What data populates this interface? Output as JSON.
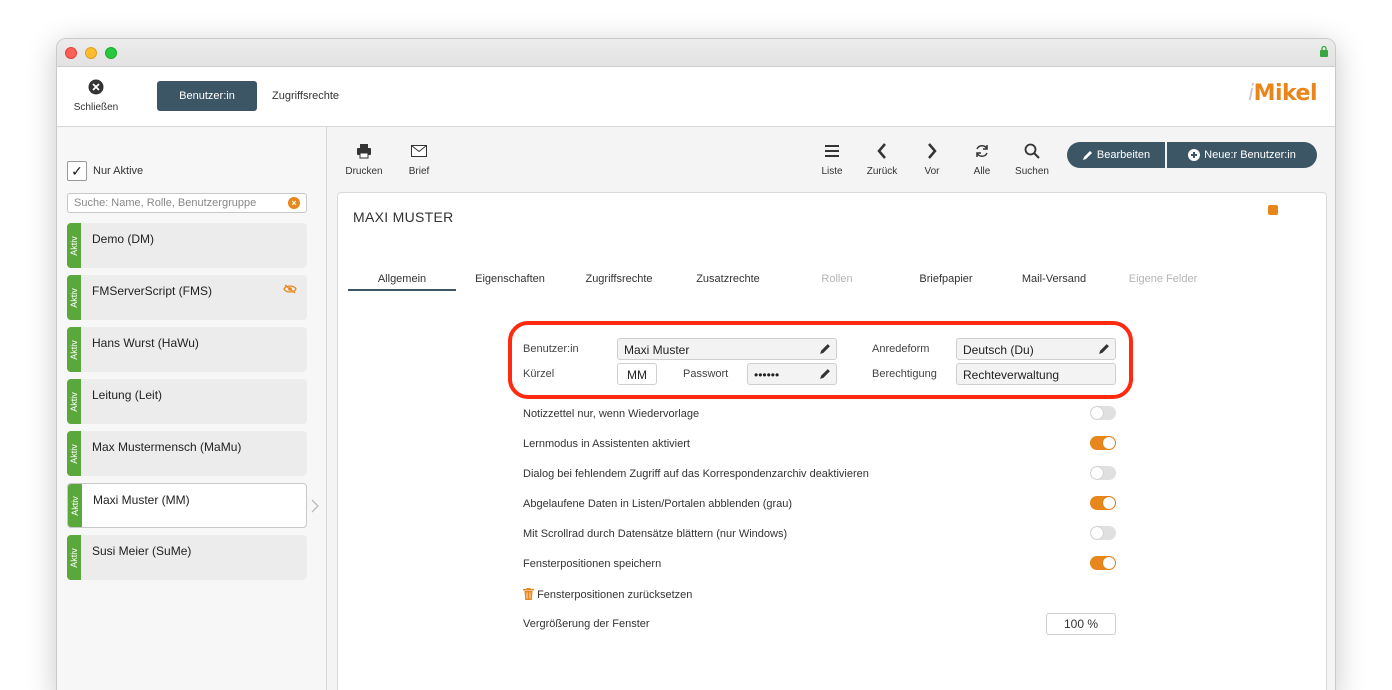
{
  "window": {
    "colors": {
      "accent": "#3d5666",
      "brand": "#e8861b",
      "active_green": "#5aa83c",
      "highlight": "#ff2a10"
    }
  },
  "topbar": {
    "close_label": "Schließen",
    "tab_users": "Benutzer:in",
    "tab_access": "Zugriffsrechte",
    "logo_i": "i",
    "logo_text": "Mikel"
  },
  "sidebar": {
    "filter_label": "Nur Aktive",
    "filter_checked": true,
    "search_placeholder": "Suche: Name, Rolle, Benutzergruppe",
    "status_label": "Aktiv",
    "items": [
      {
        "label": "Demo (DM)"
      },
      {
        "label": "FMServerScript (FMS)"
      },
      {
        "label": "Hans Wurst (HaWu)"
      },
      {
        "label": "Leitung (Leit)"
      },
      {
        "label": "Max Mustermensch (MaMu)"
      },
      {
        "label": "Maxi Muster (MM)"
      },
      {
        "label": "Susi Meier (SuMe)"
      }
    ]
  },
  "toolbar": {
    "print": "Drucken",
    "letter": "Brief",
    "list": "Liste",
    "back": "Zurück",
    "forward": "Vor",
    "all": "Alle",
    "search": "Suchen",
    "edit": "Bearbeiten",
    "new_user": "Neue:r Benutzer:in"
  },
  "record": {
    "title": "MAXI MUSTER",
    "tabs": [
      {
        "label": "Allgemein"
      },
      {
        "label": "Eigenschaften"
      },
      {
        "label": "Zugriffsrechte"
      },
      {
        "label": "Zusatzrechte"
      },
      {
        "label": "Rollen"
      },
      {
        "label": "Briefpapier"
      },
      {
        "label": "Mail-Versand"
      },
      {
        "label": "Eigene Felder"
      }
    ],
    "form": {
      "user_label": "Benutzer:in",
      "user_value": "Maxi Muster",
      "salutation_label": "Anredeform",
      "salutation_value": "Deutsch (Du)",
      "short_label": "Kürzel",
      "short_value": "MM",
      "password_label": "Passwort",
      "password_value": "••••••",
      "permission_label": "Berechtigung",
      "permission_value": "Rechteverwaltung"
    },
    "settings": [
      {
        "label": "Notizzettel nur, wenn Wiedervorlage",
        "on": false
      },
      {
        "label": "Lernmodus in Assistenten aktiviert",
        "on": true
      },
      {
        "label": "Dialog bei fehlendem Zugriff auf das Korrespondenzarchiv deaktivieren",
        "on": false
      },
      {
        "label": "Abgelaufene Daten in Listen/Portalen abblenden (grau)",
        "on": true
      },
      {
        "label": "Mit Scrollrad durch Datensätze blättern (nur Windows)",
        "on": false
      },
      {
        "label": "Fensterpositionen speichern",
        "on": true
      }
    ],
    "reset_label": "Fensterpositionen zurücksetzen",
    "zoom_label": "Vergrößerung der Fenster",
    "zoom_value": "100 %"
  }
}
